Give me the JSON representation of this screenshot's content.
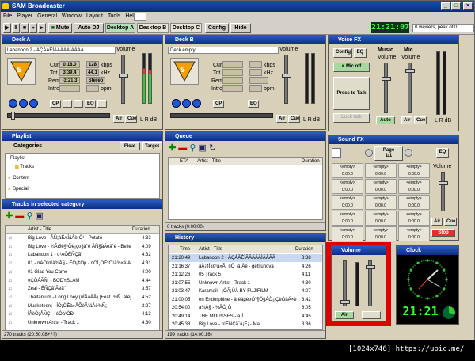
{
  "app": {
    "title": "SAM Broadcaster"
  },
  "menu": [
    "File",
    "Player",
    "General",
    "Window",
    "Layout",
    "Tools",
    "Help"
  ],
  "toolbar": {
    "mute": "Mute",
    "auto_dj": "Auto DJ",
    "tabs": [
      "Desktop A",
      "Desktop B",
      "Desktop C"
    ],
    "config": "Config",
    "hide": "Hide",
    "time": "21:21:07",
    "viewers": "0 viewers, peak of 0"
  },
  "deckA": {
    "title": "Deck A",
    "track": "Labanoon 2 - ÃÇÁÃÈÌÃÃÁÃÃÌÃÂÃÃ",
    "cur_label": "Cur",
    "cur": "0:18.0",
    "kbps": "128",
    "kbps_unit": "kbps",
    "tot_label": "Tot",
    "tot": "3:39.4",
    "khz": "44.1",
    "khz_unit": "kHz",
    "rem_label": "Rem",
    "rem": "-3:21.3",
    "mode": "Stereo",
    "intro_label": "Intro",
    "bpm_label": "bpm",
    "volume_label": "Volume",
    "air": "Air",
    "cue": "Cue",
    "lr": "L R dB",
    "cp": "CP",
    "eq": "EQ"
  },
  "deckB": {
    "title": "Deck B",
    "track": "Deck empty",
    "cur_label": "Cur",
    "tot_label": "Tot",
    "kbps_unit": "kbps",
    "khz_unit": "kHz",
    "rem_label": "Rem",
    "intro_label": "Intro",
    "bpm_label": "bpm",
    "volume_label": "Volume",
    "air": "Air",
    "cue": "Cue",
    "lr": "L R dB",
    "cp": "CP",
    "eq": "EQ"
  },
  "voicefx": {
    "title": "Voice FX",
    "config": "Config",
    "eq": "EQ",
    "music": "Music",
    "mic": "Mic",
    "mic_off": "Mic off",
    "press_to_talk": "Press to Talk",
    "lock_talk": "Lock talk",
    "volume": "Volume",
    "auto": "Auto",
    "air": "Air",
    "cue": "Cue",
    "lr": "L R dB"
  },
  "playlist": {
    "title": "Playlist",
    "categories": "Categories",
    "float": "Float",
    "target": "Target",
    "tree": [
      "Playlist",
      "Tracks",
      "Content",
      "Special"
    ]
  },
  "tracks": {
    "title": "Tracks in selected category",
    "col_artist": "Artist - Title",
    "col_duration": "Duration",
    "rows": [
      [
        "Big Love - ÃÑ¡àÊÁÍäÁè¡Ò¹ - Potato",
        "4:33"
      ],
      [
        "Big Love - ¾ÃØè§¹Õé¡ç¤§ä´é ÂÑ§äÁèä´é - Belle Supol",
        "4:09"
      ],
      [
        "Labanoon 1 - ¤¹ÁÕËÑÇã¨",
        "4:32"
      ],
      [
        "01 - ¤ÃÒ¹¤¹à¾Å§ - ÊÔ¡¢Ôµ - ¤ÓÍ¸ÔÉ°Ò¹à¾×èÍÃÑ¡",
        "4:31"
      ],
      [
        "01 Glad You Came",
        "4:00"
      ],
      [
        "¤ÇÒÁÃÑ¡ - BODYSLAM",
        "4:44"
      ],
      [
        "Zeal - ËÑÇã¨Ãéã¨",
        "3:57"
      ],
      [
        "Thaitanium - Long Loey (¤ÍÅàÅÂ) [Feat. ¾Ñ´ àÍé]",
        "4:52"
      ],
      [
        "Musketeers - ÍÒ¡ÒÈà»ÅÕèÂ¹äÁè¾Ñ¡",
        "3:27"
      ],
      [
        "ÍÂèÒ¡ÅÑÇ - ¹éÓà¹ÒÐ",
        "4:13"
      ],
      [
        "Unknown Artist - Track 1",
        "4:30"
      ]
    ],
    "status": "270 tracks (20:50:08+??)"
  },
  "queue": {
    "title": "Queue",
    "col_eta": "ETA",
    "col_artist": "Artist - Title",
    "col_duration": "Duration",
    "status": "0 tracks (0:00:00)"
  },
  "history": {
    "title": "History",
    "col_time": "Time",
    "col_artist": "Artist - Title",
    "col_duration": "Duration",
    "rows": [
      [
        "21:20:49",
        "Labanoon 2 - ÃÇÁÃÈÌÃÃÁÃÃÌÃÂÃÃ",
        "3:38"
      ],
      [
        "21:16:37",
        "âÅ¡¢Í§¤¹â»Ã´ ¤Ô´ ä¡Åè - getsunova",
        "4:26"
      ],
      [
        "21:12:26",
        "05 Track 5",
        "4:11"
      ],
      [
        "21:07:55",
        "Unknown Artist - Track 1",
        "4:30"
      ],
      [
        "21:03:47",
        "Karamail - ¡ÒÃ¡ÙÅ BY FUJIFILM",
        "4:07"
      ],
      [
        "21:00:05",
        "en Endorphine - ä´éáµè¤Ô´¶Ö§ÁÒ¡¡ÇèÒàÁ×èÍÇÒ¹",
        "3:42"
      ],
      [
        "20:54:00",
        "à¾Å§ - ¾ÂÒ¸Ô",
        "6:05"
      ],
      [
        "20:49:14",
        "THE MOUSSES - à¸Í",
        "4:45"
      ],
      [
        "20:45:38",
        "Big Love - ¤¹ËÑÇã¨â¡Ë¡ - Mal...",
        "3:36"
      ]
    ],
    "status": "199 tracks (14:00:16)"
  },
  "soundfx": {
    "title": "Sound FX",
    "page": "Page",
    "page_num": "1/1",
    "eq": "EQ",
    "empty": "<empty>",
    "time": "0:00.0",
    "volume": "Volume",
    "air": "Air",
    "cue": "Cue",
    "stop": "Stop"
  },
  "volume_panel": {
    "title": "Volume",
    "air": "Air"
  },
  "clock": {
    "title": "Clock",
    "time": "21:21"
  },
  "watermark": "[1024x746] https://upic.me/",
  "colors": {
    "titlebar": "#0b2e82",
    "panel_bg": "#d8d0b8",
    "highlight_box": "#e00000",
    "lcd_green": "#3c3"
  }
}
